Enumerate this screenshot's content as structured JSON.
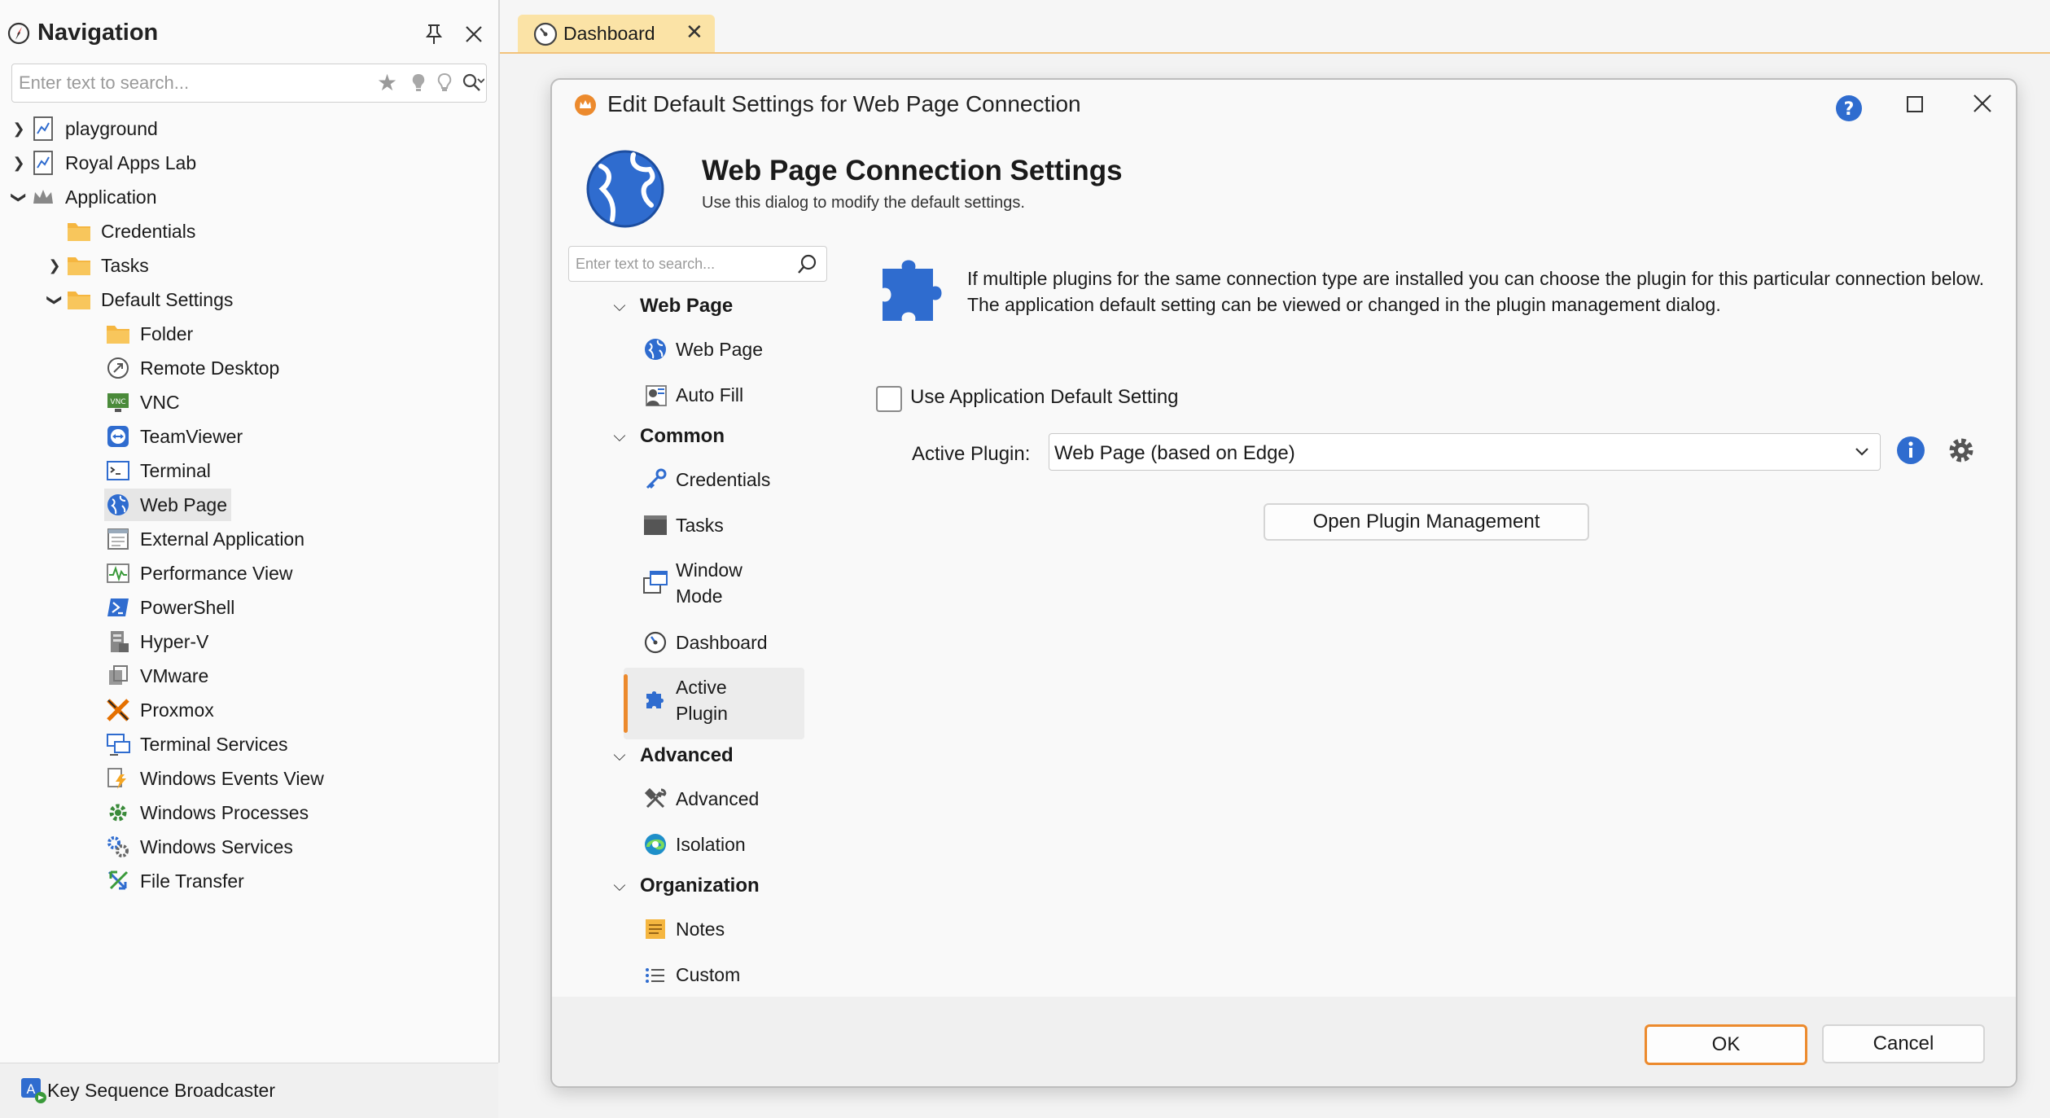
{
  "navigation": {
    "title": "Navigation",
    "search_placeholder": "Enter text to search...",
    "tree": [
      {
        "label": "playground",
        "level": 0,
        "expander": "collapsed",
        "icon": "document-chart-icon"
      },
      {
        "label": "Royal Apps Lab",
        "level": 0,
        "expander": "collapsed",
        "icon": "document-chart-icon"
      },
      {
        "label": "Application",
        "level": 0,
        "expander": "expanded",
        "icon": "crown-icon"
      },
      {
        "label": "Credentials",
        "level": 1,
        "expander": "none",
        "icon": "folder-icon"
      },
      {
        "label": "Tasks",
        "level": 1,
        "expander": "collapsed",
        "icon": "folder-icon"
      },
      {
        "label": "Default Settings",
        "level": 1,
        "expander": "expanded",
        "icon": "folder-icon"
      },
      {
        "label": "Folder",
        "level": 2,
        "icon": "folder-icon"
      },
      {
        "label": "Remote Desktop",
        "level": 2,
        "icon": "remote-desktop-icon"
      },
      {
        "label": "VNC",
        "level": 2,
        "icon": "vnc-icon"
      },
      {
        "label": "TeamViewer",
        "level": 2,
        "icon": "teamviewer-icon"
      },
      {
        "label": "Terminal",
        "level": 2,
        "icon": "terminal-icon"
      },
      {
        "label": "Web Page",
        "level": 2,
        "icon": "globe-icon",
        "selected": true
      },
      {
        "label": "External Application",
        "level": 2,
        "icon": "external-app-icon"
      },
      {
        "label": "Performance View",
        "level": 2,
        "icon": "performance-icon"
      },
      {
        "label": "PowerShell",
        "level": 2,
        "icon": "powershell-icon"
      },
      {
        "label": "Hyper-V",
        "level": 2,
        "icon": "hyperv-icon"
      },
      {
        "label": "VMware",
        "level": 2,
        "icon": "vmware-icon"
      },
      {
        "label": "Proxmox",
        "level": 2,
        "icon": "proxmox-icon"
      },
      {
        "label": "Terminal Services",
        "level": 2,
        "icon": "terminal-services-icon"
      },
      {
        "label": "Windows Events View",
        "level": 2,
        "icon": "events-icon"
      },
      {
        "label": "Windows Processes",
        "level": 2,
        "icon": "processes-icon"
      },
      {
        "label": "Windows Services",
        "level": 2,
        "icon": "services-icon"
      },
      {
        "label": "File Transfer",
        "level": 2,
        "icon": "file-transfer-icon"
      }
    ],
    "bottom_label": "Key Sequence Broadcaster"
  },
  "tabs": [
    {
      "label": "Dashboard",
      "active": true
    }
  ],
  "dialog": {
    "title": "Edit Default Settings for Web Page Connection",
    "header_title": "Web Page Connection Settings",
    "header_subtitle": "Use this dialog to modify the default settings.",
    "search_placeholder": "Enter text to search...",
    "groups": [
      {
        "label": "Web Page",
        "items": [
          {
            "label": "Web Page",
            "icon": "globe-icon"
          },
          {
            "label": "Auto Fill",
            "icon": "autofill-icon"
          }
        ]
      },
      {
        "label": "Common",
        "items": [
          {
            "label": "Credentials",
            "icon": "key-icon"
          },
          {
            "label": "Tasks",
            "icon": "tasks-icon"
          },
          {
            "label": "Window Mode",
            "icon": "window-mode-icon",
            "lines": [
              "Window",
              "Mode"
            ]
          },
          {
            "label": "Dashboard",
            "icon": "dashboard-icon"
          },
          {
            "label": "Active Plugin",
            "icon": "puzzle-icon",
            "lines": [
              "Active",
              "Plugin"
            ],
            "selected": true
          }
        ]
      },
      {
        "label": "Advanced",
        "items": [
          {
            "label": "Advanced",
            "icon": "tools-icon"
          },
          {
            "label": "Isolation",
            "icon": "edge-icon"
          }
        ]
      },
      {
        "label": "Organization",
        "items": [
          {
            "label": "Notes",
            "icon": "notes-icon"
          },
          {
            "label": "Custom",
            "icon": "custom-list-icon"
          }
        ]
      }
    ],
    "info_text": "If multiple plugins for the same connection type are installed you can choose the plugin for this particular connection below. The application default setting can be viewed or changed in the plugin management dialog.",
    "use_default_label": "Use Application Default Setting",
    "use_default_checked": false,
    "active_plugin_label": "Active Plugin:",
    "active_plugin_value": "Web Page (based on Edge)",
    "open_plugin_management": "Open Plugin Management",
    "ok_label": "OK",
    "cancel_label": "Cancel"
  },
  "colors": {
    "accent_orange": "#ec8a2d",
    "tab_bg": "#fbe3a6",
    "icon_blue": "#2f6ccf",
    "folder_yellow": "#f5b640"
  }
}
